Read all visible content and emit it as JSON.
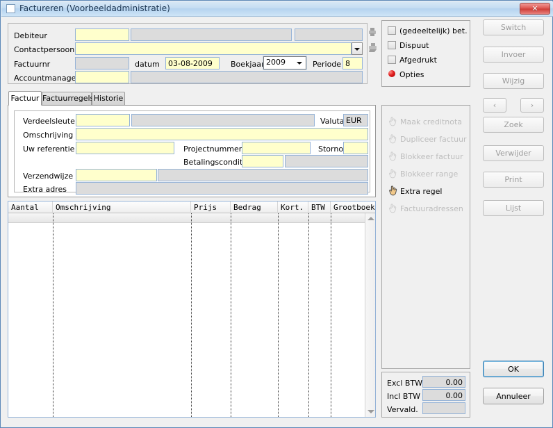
{
  "window": {
    "title": "Factureren (Voorbeeldadministratie)",
    "close_label": "✕",
    "icon": "window-icon"
  },
  "header_form": {
    "debiteur_label": "Debiteur",
    "debiteur_code": "",
    "debiteur_name": "",
    "debiteur_extra": "",
    "contactpersoon_label": "Contactpersoon",
    "contactpersoon_value": "",
    "factuurnr_label": "Factuurnr",
    "factuurnr_value": "",
    "datum_label": "datum",
    "datum_value": "03-08-2009",
    "boekjaar_label": "Boekjaar",
    "boekjaar_value": "2009",
    "periode_label": "Periode",
    "periode_value": "8",
    "accountmanager_label": "Accountmanager",
    "accountmanager_code": "",
    "accountmanager_name": ""
  },
  "status_panel": {
    "items": [
      {
        "label": "(gedeeltelijk) bet.",
        "checked": false
      },
      {
        "label": "Dispuut",
        "checked": false
      },
      {
        "label": "Afgedrukt",
        "checked": false
      }
    ],
    "opties_label": "Opties",
    "opties_color": "#e02020"
  },
  "tabs": [
    {
      "label": "Factuur",
      "active": true
    },
    {
      "label": "Factuurregels",
      "active": false
    },
    {
      "label": "Historie",
      "active": false
    }
  ],
  "factuur_form": {
    "verdeelsleutel_label": "Verdeelsleutel",
    "verdeelsleutel_code": "",
    "verdeelsleutel_name": "",
    "valuta_label": "Valuta",
    "valuta_value": "EUR",
    "omschrijving_label": "Omschrijving",
    "omschrijving_value": "",
    "uw_referentie_label": "Uw referentie",
    "uw_referentie_value": "",
    "projectnummer_label": "Projectnummer",
    "projectnummer_value": "",
    "storno_label": "Storno",
    "storno_value": "",
    "betalingsconditie_label": "Betalingsconditie",
    "betalingsconditie_code": "",
    "betalingsconditie_name": "",
    "verzendwijze_label": "Verzendwijze",
    "verzendwijze_code": "",
    "verzendwijze_name": "",
    "extra_adres_label": "Extra adres",
    "extra_adres_value": ""
  },
  "grid": {
    "columns": [
      {
        "label": "Aantal"
      },
      {
        "label": "Omschrijving"
      },
      {
        "label": "Prijs"
      },
      {
        "label": "Bedrag"
      },
      {
        "label": "Kort."
      },
      {
        "label": "BTW"
      },
      {
        "label": "Grootboek"
      }
    ],
    "rows": []
  },
  "actions": [
    {
      "label": "Maak creditnota",
      "enabled": false,
      "icon": "hand-pointer-icon"
    },
    {
      "label": "Dupliceer factuur",
      "enabled": false,
      "icon": "hand-pointer-icon"
    },
    {
      "label": "Blokkeer factuur",
      "enabled": false,
      "icon": "hand-pointer-icon"
    },
    {
      "label": "Blokkeer range",
      "enabled": false,
      "icon": "hand-pointer-icon"
    },
    {
      "label": "Extra regel",
      "enabled": true,
      "icon": "hand-pointer-icon"
    },
    {
      "label": "Factuuradressen",
      "enabled": false,
      "icon": "hand-pointer-icon"
    }
  ],
  "totals": {
    "excl_label": "Excl BTW",
    "excl_value": "0.00",
    "incl_label": "Incl BTW",
    "incl_value": "0.00",
    "vervald_label": "Vervald.",
    "vervald_value": ""
  },
  "toolbar": {
    "switch_label": "Switch",
    "invoer_label": "Invoer",
    "wijzig_label": "Wijzig",
    "prev_label": "‹",
    "next_label": "›",
    "zoek_label": "Zoek",
    "verwijder_label": "Verwijder",
    "print_label": "Print",
    "lijst_label": "Lijst",
    "ok_label": "OK",
    "annuleer_label": "Annuleer"
  }
}
